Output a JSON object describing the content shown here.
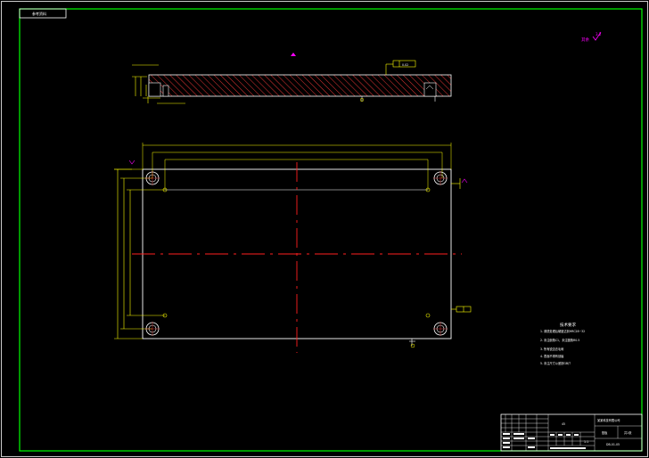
{
  "drawing": {
    "tag_label": "参考资料",
    "roughness_top_right": "其余",
    "roughness_value": "3.2",
    "section_callout": "A",
    "flatness_callout": "0.02",
    "bottom_datum": "A",
    "right_tolerance": "0.01 A",
    "tech_req_title": "技术要求",
    "tech_requirements": [
      "1. 调质处理后硬度达到HRC28~32",
      "2. 未注倒角C1，未注圆角R0.5",
      "3. 所有锐边去毛刺",
      "4. 表面不得有划痕",
      "5. 未注尺寸公差按GB/T"
    ],
    "title_block": {
      "material": "45",
      "designer_company": "某某科技有限公司",
      "part_name": "垫板",
      "drawing_number": "DB-01-05",
      "scale": "1:1",
      "sheet": "共1张"
    }
  },
  "colors": {
    "background": "#000000",
    "geometry": "#ffffff",
    "dimension": "#ffff00",
    "centerline": "#ff0000",
    "hatch": "#ff3b3b",
    "callout": "#ff00ff",
    "border": "#00ff00"
  }
}
